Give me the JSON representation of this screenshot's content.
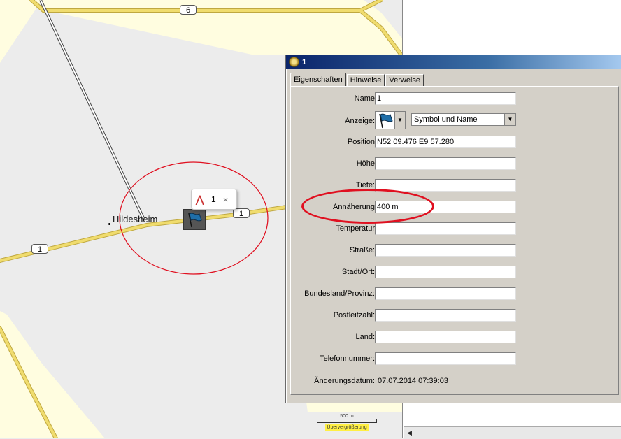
{
  "map": {
    "road_shields": [
      "6",
      "1",
      "1"
    ],
    "city_name": "Hildesheim",
    "popup": {
      "number": "1",
      "close": "×"
    },
    "scale": {
      "distance": "500 m",
      "badge": "Übervergrößerung"
    }
  },
  "dialog": {
    "title": "1",
    "tabs": [
      "Eigenschaften",
      "Hinweise",
      "Verweise"
    ],
    "fields": {
      "name": {
        "label": "Name",
        "value": "1"
      },
      "anzeige": {
        "label": "Anzeige:",
        "value": "Symbol und Name"
      },
      "position": {
        "label": "Position",
        "value": "N52 09.476 E9 57.280"
      },
      "hoehe": {
        "label": "Höhe",
        "value": ""
      },
      "tiefe": {
        "label": "Tiefe:",
        "value": ""
      },
      "annaeherung": {
        "label": "Annäherung",
        "value": "400 m"
      },
      "temperatur": {
        "label": "Temperatur",
        "value": ""
      },
      "strasse": {
        "label": "Straße:",
        "value": ""
      },
      "stadt": {
        "label": "Stadt/Ort:",
        "value": ""
      },
      "bundesland": {
        "label": "Bundesland/Provinz:",
        "value": ""
      },
      "plz": {
        "label": "Postleitzahl:",
        "value": ""
      },
      "land": {
        "label": "Land:",
        "value": ""
      },
      "telefon": {
        "label": "Telefonnummer:",
        "value": ""
      },
      "datum": {
        "label": "Änderungsdatum:",
        "value": "07.07.2014 07:39:03"
      }
    }
  },
  "colors": {
    "road": "#f0dc6e",
    "area_yellow": "#fffde0",
    "area_gray": "#ececec",
    "annotation_red": "#e01020",
    "titlebar": "#0a246a"
  }
}
